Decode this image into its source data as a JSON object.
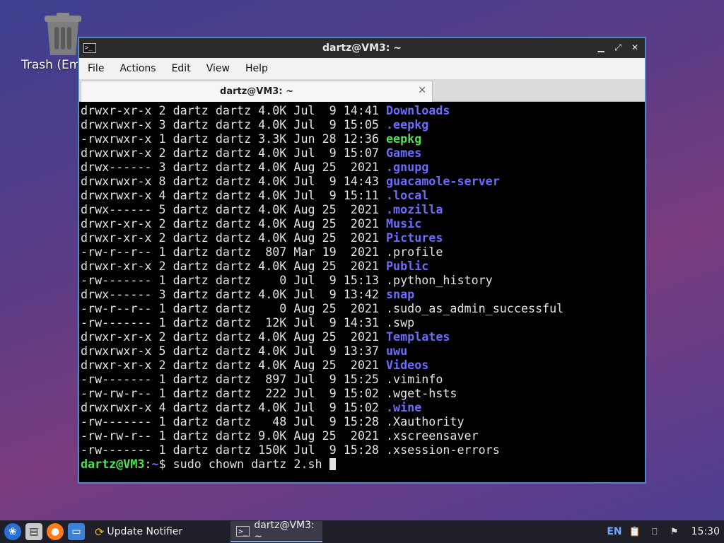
{
  "desktop": {
    "trash_label": "Trash (Em"
  },
  "window": {
    "title": "dartz@VM3: ~",
    "menu": [
      "File",
      "Actions",
      "Edit",
      "View",
      "Help"
    ],
    "tab_title": "dartz@VM3: ~",
    "controls": [
      "minimize",
      "maximize",
      "close"
    ]
  },
  "terminal": {
    "listing": [
      {
        "perms": "drwxr-xr-x",
        "links": "2",
        "user": "dartz",
        "group": "dartz",
        "size": "4.0K",
        "mon": "Jul",
        "day": "9",
        "time": "14:41",
        "name": "Downloads",
        "kind": "dir"
      },
      {
        "perms": "drwxrwxr-x",
        "links": "3",
        "user": "dartz",
        "group": "dartz",
        "size": "4.0K",
        "mon": "Jul",
        "day": "9",
        "time": "15:05",
        "name": ".eepkg",
        "kind": "dir"
      },
      {
        "perms": "-rwxrwxr-x",
        "links": "1",
        "user": "dartz",
        "group": "dartz",
        "size": "3.3K",
        "mon": "Jun",
        "day": "28",
        "time": "12:36",
        "name": "eepkg",
        "kind": "exe"
      },
      {
        "perms": "drwxrwxr-x",
        "links": "2",
        "user": "dartz",
        "group": "dartz",
        "size": "4.0K",
        "mon": "Jul",
        "day": "9",
        "time": "15:07",
        "name": "Games",
        "kind": "dir"
      },
      {
        "perms": "drwx------",
        "links": "3",
        "user": "dartz",
        "group": "dartz",
        "size": "4.0K",
        "mon": "Aug",
        "day": "25",
        "time": "2021",
        "name": ".gnupg",
        "kind": "dir"
      },
      {
        "perms": "drwxrwxr-x",
        "links": "8",
        "user": "dartz",
        "group": "dartz",
        "size": "4.0K",
        "mon": "Jul",
        "day": "9",
        "time": "14:43",
        "name": "guacamole-server",
        "kind": "dir"
      },
      {
        "perms": "drwxrwxr-x",
        "links": "4",
        "user": "dartz",
        "group": "dartz",
        "size": "4.0K",
        "mon": "Jul",
        "day": "9",
        "time": "15:11",
        "name": ".local",
        "kind": "dir"
      },
      {
        "perms": "drwx------",
        "links": "5",
        "user": "dartz",
        "group": "dartz",
        "size": "4.0K",
        "mon": "Aug",
        "day": "25",
        "time": "2021",
        "name": ".mozilla",
        "kind": "dir"
      },
      {
        "perms": "drwxr-xr-x",
        "links": "2",
        "user": "dartz",
        "group": "dartz",
        "size": "4.0K",
        "mon": "Aug",
        "day": "25",
        "time": "2021",
        "name": "Music",
        "kind": "dir"
      },
      {
        "perms": "drwxr-xr-x",
        "links": "2",
        "user": "dartz",
        "group": "dartz",
        "size": "4.0K",
        "mon": "Aug",
        "day": "25",
        "time": "2021",
        "name": "Pictures",
        "kind": "dir"
      },
      {
        "perms": "-rw-r--r--",
        "links": "1",
        "user": "dartz",
        "group": "dartz",
        "size": "807",
        "mon": "Mar",
        "day": "19",
        "time": "2021",
        "name": ".profile",
        "kind": "file"
      },
      {
        "perms": "drwxr-xr-x",
        "links": "2",
        "user": "dartz",
        "group": "dartz",
        "size": "4.0K",
        "mon": "Aug",
        "day": "25",
        "time": "2021",
        "name": "Public",
        "kind": "dir"
      },
      {
        "perms": "-rw-------",
        "links": "1",
        "user": "dartz",
        "group": "dartz",
        "size": "0",
        "mon": "Jul",
        "day": "9",
        "time": "15:13",
        "name": ".python_history",
        "kind": "file"
      },
      {
        "perms": "drwx------",
        "links": "3",
        "user": "dartz",
        "group": "dartz",
        "size": "4.0K",
        "mon": "Jul",
        "day": "9",
        "time": "13:42",
        "name": "snap",
        "kind": "dir"
      },
      {
        "perms": "-rw-r--r--",
        "links": "1",
        "user": "dartz",
        "group": "dartz",
        "size": "0",
        "mon": "Aug",
        "day": "25",
        "time": "2021",
        "name": ".sudo_as_admin_successful",
        "kind": "file"
      },
      {
        "perms": "-rw-------",
        "links": "1",
        "user": "dartz",
        "group": "dartz",
        "size": "12K",
        "mon": "Jul",
        "day": "9",
        "time": "14:31",
        "name": ".swp",
        "kind": "file"
      },
      {
        "perms": "drwxr-xr-x",
        "links": "2",
        "user": "dartz",
        "group": "dartz",
        "size": "4.0K",
        "mon": "Aug",
        "day": "25",
        "time": "2021",
        "name": "Templates",
        "kind": "dir"
      },
      {
        "perms": "drwxrwxr-x",
        "links": "5",
        "user": "dartz",
        "group": "dartz",
        "size": "4.0K",
        "mon": "Jul",
        "day": "9",
        "time": "13:37",
        "name": "uwu",
        "kind": "dir"
      },
      {
        "perms": "drwxr-xr-x",
        "links": "2",
        "user": "dartz",
        "group": "dartz",
        "size": "4.0K",
        "mon": "Aug",
        "day": "25",
        "time": "2021",
        "name": "Videos",
        "kind": "dir"
      },
      {
        "perms": "-rw-------",
        "links": "1",
        "user": "dartz",
        "group": "dartz",
        "size": "897",
        "mon": "Jul",
        "day": "9",
        "time": "15:25",
        "name": ".viminfo",
        "kind": "file"
      },
      {
        "perms": "-rw-rw-r--",
        "links": "1",
        "user": "dartz",
        "group": "dartz",
        "size": "222",
        "mon": "Jul",
        "day": "9",
        "time": "15:02",
        "name": ".wget-hsts",
        "kind": "file"
      },
      {
        "perms": "drwxrwxr-x",
        "links": "4",
        "user": "dartz",
        "group": "dartz",
        "size": "4.0K",
        "mon": "Jul",
        "day": "9",
        "time": "15:02",
        "name": ".wine",
        "kind": "dir"
      },
      {
        "perms": "-rw-------",
        "links": "1",
        "user": "dartz",
        "group": "dartz",
        "size": "48",
        "mon": "Jul",
        "day": "9",
        "time": "15:28",
        "name": ".Xauthority",
        "kind": "file"
      },
      {
        "perms": "-rw-rw-r--",
        "links": "1",
        "user": "dartz",
        "group": "dartz",
        "size": "9.0K",
        "mon": "Aug",
        "day": "25",
        "time": "2021",
        "name": ".xscreensaver",
        "kind": "file"
      },
      {
        "perms": "-rw-------",
        "links": "1",
        "user": "dartz",
        "group": "dartz",
        "size": "150K",
        "mon": "Jul",
        "day": "9",
        "time": "15:28",
        "name": ".xsession-errors",
        "kind": "file"
      }
    ],
    "prompt_user": "dartz@VM3",
    "prompt_sep": ":",
    "prompt_path": "~",
    "prompt_symbol": "$ ",
    "command": "sudo chown dartz 2.sh "
  },
  "taskbar": {
    "launchers": [
      "start-menu-icon",
      "file-manager-icon",
      "firefox-icon",
      "show-desktop-icon"
    ],
    "tasks": [
      {
        "label": "Update Notifier",
        "icon": "update-notifier-icon",
        "active": false
      },
      {
        "label": "dartz@VM3: ~",
        "icon": "terminal-icon",
        "active": true
      }
    ],
    "lang": "EN",
    "clock": "15:30"
  },
  "colors": {
    "directory": "#6b6bff",
    "executable": "#4fe04f",
    "prompt_user": "#4fe04f",
    "window_border": "#4f86c6"
  }
}
